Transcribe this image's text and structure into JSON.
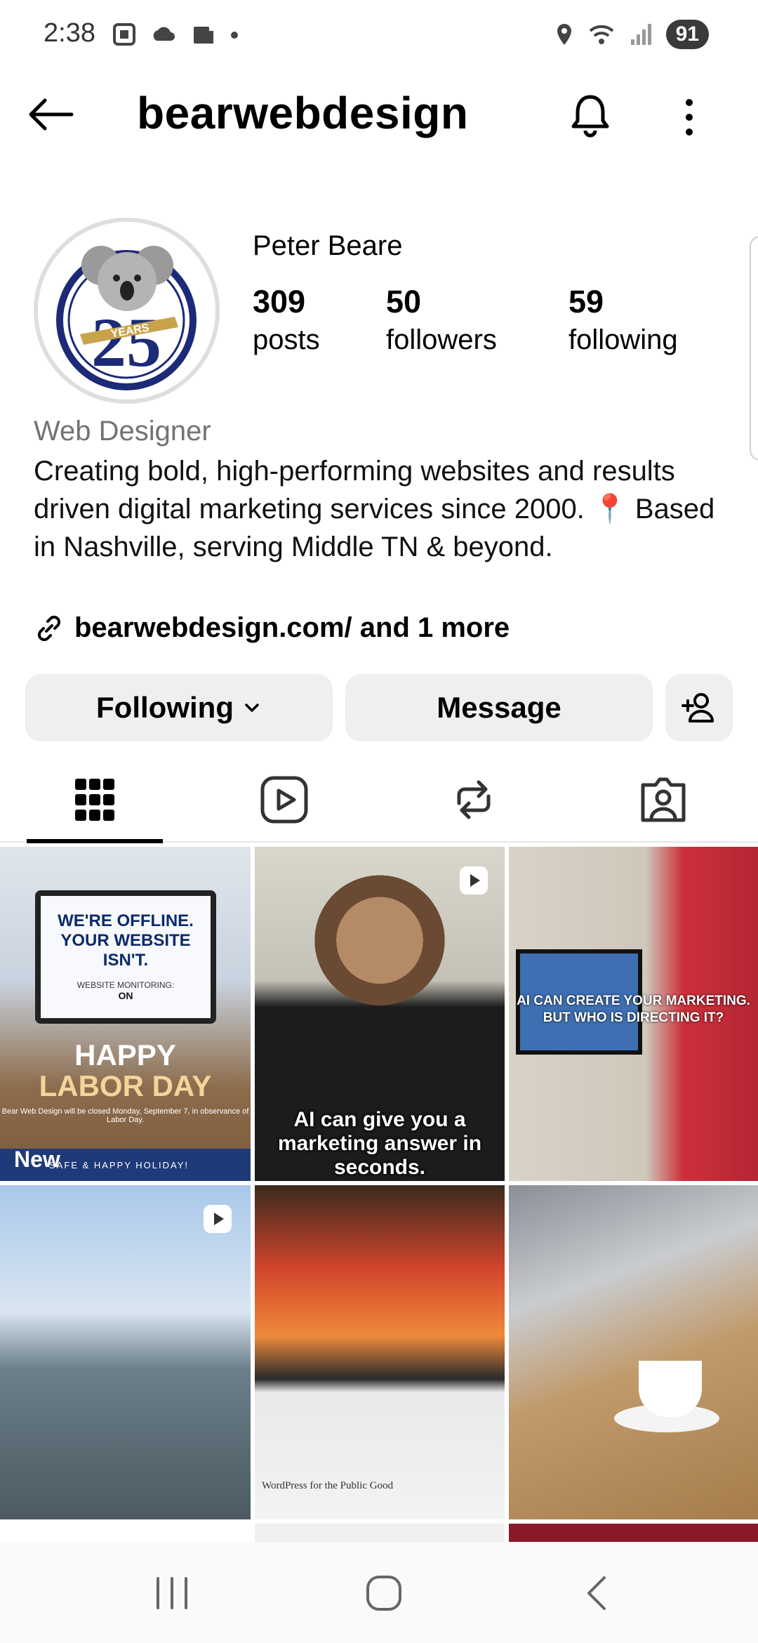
{
  "status_bar": {
    "time": "2:38",
    "battery": "91"
  },
  "header": {
    "username": "bearwebdesign"
  },
  "profile": {
    "avatar_text": "25",
    "avatar_ribbon": "YEARS",
    "display_name": "Peter Beare",
    "posts": {
      "count": "309",
      "label": "posts"
    },
    "followers": {
      "count": "50",
      "label": "followers"
    },
    "following": {
      "count": "59",
      "label": "following"
    },
    "category": "Web Designer",
    "bio": "Creating bold, high-performing websites and results driven digital marketing services since 2000. 📍 Based in Nashville, serving Middle TN & beyond.",
    "link": "bearwebdesign.com/ and 1 more"
  },
  "actions": {
    "following_label": "Following",
    "message_label": "Message"
  },
  "grid": {
    "tile1": {
      "laptop_line1": "WE'RE OFFLINE.",
      "laptop_line2": "YOUR WEBSITE ISN'T.",
      "monitoring_label": "WEBSITE MONITORING:",
      "monitoring_value": "ON",
      "headline1": "HAPPY",
      "headline2": "LABOR DAY",
      "small_text": "Bear Web Design will be closed Monday, September 7, in observance of Labor Day.",
      "band_text": "SAFE & HAPPY HOLIDAY!",
      "badge": "New"
    },
    "tile2": {
      "caption": "AI can give you a marketing answer in seconds."
    },
    "tile3": {
      "caption": "AI CAN CREATE YOUR MARKETING. BUT WHO IS DIRECTING IT?"
    },
    "tile5": {
      "caption": "WordPress for the Public Good"
    }
  }
}
